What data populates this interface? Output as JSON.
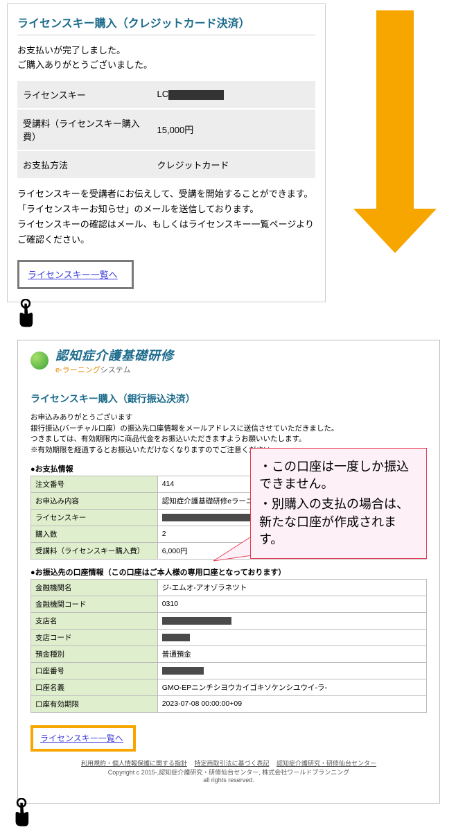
{
  "card1": {
    "title": "ライセンスキー購入（クレジットカード決済）",
    "msg1": "お支払いが完了しました。",
    "msg2": "ご購入ありがとうございました。",
    "rows": [
      {
        "label": "ライセンスキー",
        "value_prefix": "LC",
        "redacted": true
      },
      {
        "label": "受講料（ライセンスキー購入費）",
        "value": "15,000円"
      },
      {
        "label": "お支払方法",
        "value": "クレジットカード"
      }
    ],
    "note1": "ライセンスキーを受講者にお伝えして、受講を開始することができます。",
    "note2": "「ライセンスキーお知らせ」のメールを送信しております。",
    "note3": "ライセンスキーの確認はメール、もしくはライセンスキー一覧ページよりご確認ください。",
    "link_label": "ライセンスキー一覧へ"
  },
  "card2": {
    "logo_main": "認知症介護基礎研修",
    "logo_sub_accent": "e-ラーニング",
    "logo_sub_rest": "システム",
    "title": "ライセンスキー購入（銀行振込決済）",
    "msg1": "お申込みありがとうございます",
    "msg2": "銀行振込(バーチャル口座）の振込先口座情報をメールアドレスに送信させていただきました。",
    "msg3": "つきましては、有効期限内に商品代金をお振込いただきますようお願いいたします。",
    "msg4": "※有効期限を経過するとお振込いただけなくなりますのでご注意ください。",
    "sect1": "●お支払情報",
    "table1": [
      {
        "label": "注文番号",
        "value": "414"
      },
      {
        "label": "お申込み内容",
        "value": "認知症介護基礎研修eラーニング一括支払い"
      },
      {
        "label": "ライセンスキー",
        "redacted": true,
        "rw": 130
      },
      {
        "label": "購入数",
        "value": "2"
      },
      {
        "label": "受講料（ライセンスキー購入費）",
        "value": "6,000円"
      }
    ],
    "sect2": "●お振込先の口座情報（この口座はご本人様の専用口座となっております）",
    "table2": [
      {
        "label": "金融機関名",
        "value": "ジ-エムオ-アオゾラネツト"
      },
      {
        "label": "金融機関コード",
        "value": "0310"
      },
      {
        "label": "支店名",
        "redacted": true,
        "rw": 100
      },
      {
        "label": "支店コード",
        "redacted": true,
        "rw": 40
      },
      {
        "label": "預金種別",
        "value": "普通預金"
      },
      {
        "label": "口座番号",
        "redacted": true,
        "rw": 60
      },
      {
        "label": "口座名義",
        "value": "GMO-EPニンチシヨウカイゴキソケンシユウイ-ラ-"
      },
      {
        "label": "口座有効期限",
        "value": "2023-07-08 00:00:00+09"
      }
    ],
    "link_label": "ライセンスキー一覧へ",
    "footer_links": [
      "利用規約・個人情報保護に関する指針",
      "特定商取引法に基づく表記",
      "認知症介護研究・研修仙台センター"
    ],
    "footer_copy": "Copyright c 2015-,認知症介護研究・研修仙台センター, 株式会社ワールドプランニング",
    "footer_rights": "all rights reserved."
  },
  "callout": {
    "line1": "・この口座は一度しか振込できません。",
    "line2": "・別購入の支払の場合は、新たな口座が作成されます。"
  }
}
